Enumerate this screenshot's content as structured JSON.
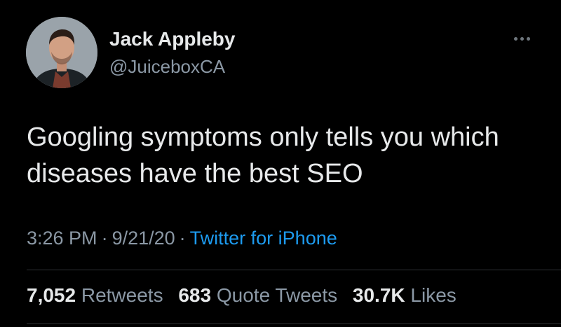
{
  "author": {
    "display_name": "Jack Appleby",
    "handle": "@JuiceboxCA",
    "avatar_icon": "person-avatar-icon"
  },
  "menu": {
    "icon": "more-horizontal-icon"
  },
  "tweet": {
    "text": "Googling symptoms only tells you which diseases have the best SEO"
  },
  "meta": {
    "time": "3:26 PM",
    "separator": "·",
    "date": "9/21/20",
    "source": "Twitter for iPhone"
  },
  "stats": {
    "retweets_count": "7,052",
    "retweets_label": "Retweets",
    "quotes_count": "683",
    "quotes_label": "Quote Tweets",
    "likes_count": "30.7K",
    "likes_label": "Likes"
  },
  "colors": {
    "background": "#000000",
    "text_primary": "#e7e9ea",
    "text_secondary": "#8b98a5",
    "link": "#1d9bf0",
    "divider": "#2f3336"
  }
}
